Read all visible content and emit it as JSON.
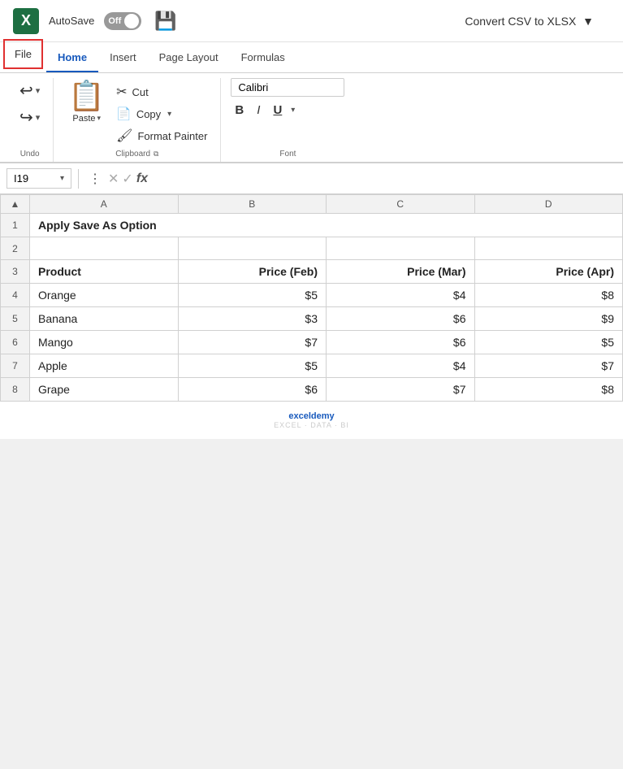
{
  "titlebar": {
    "logo": "X",
    "autosave_label": "AutoSave",
    "toggle_state": "Off",
    "title": "Convert CSV to XLSX",
    "dropdown_arrow": "▼"
  },
  "ribbon_tabs": {
    "tabs": [
      {
        "id": "file",
        "label": "File",
        "active": false,
        "highlighted": true
      },
      {
        "id": "home",
        "label": "Home",
        "active": true
      },
      {
        "id": "insert",
        "label": "Insert",
        "active": false
      },
      {
        "id": "page_layout",
        "label": "Page Layout",
        "active": false
      },
      {
        "id": "formulas",
        "label": "Formulas",
        "active": false
      }
    ]
  },
  "ribbon": {
    "undo_group": {
      "label": "Undo",
      "undo_icon": "↩",
      "redo_icon": "↪"
    },
    "clipboard_group": {
      "label": "Clipboard",
      "paste_label": "Paste",
      "cut_label": "Cut",
      "copy_label": "Copy",
      "format_painter_label": "Format Painter"
    },
    "font_group": {
      "label": "Font",
      "font_name": "Calibri",
      "bold_label": "B",
      "italic_label": "I",
      "underline_label": "U"
    }
  },
  "formula_bar": {
    "cell_ref": "I19",
    "fx_label": "fx"
  },
  "spreadsheet": {
    "col_headers": [
      "",
      "A",
      "B",
      "C",
      "D"
    ],
    "rows": [
      {
        "row_num": "1",
        "cells": [
          "Apply Save As Option",
          "",
          "",
          ""
        ]
      },
      {
        "row_num": "2",
        "cells": [
          "",
          "",
          "",
          ""
        ]
      },
      {
        "row_num": "3",
        "cells": [
          "Product",
          "Price (Feb)",
          "Price (Mar)",
          "Price (Apr)"
        ],
        "bold": true
      },
      {
        "row_num": "4",
        "cells": [
          "Orange",
          "$5",
          "$4",
          "$8"
        ]
      },
      {
        "row_num": "5",
        "cells": [
          "Banana",
          "$3",
          "$6",
          "$9"
        ]
      },
      {
        "row_num": "6",
        "cells": [
          "Mango",
          "$7",
          "$6",
          "$5"
        ]
      },
      {
        "row_num": "7",
        "cells": [
          "Apple",
          "$5",
          "$4",
          "$7"
        ]
      },
      {
        "row_num": "8",
        "cells": [
          "Grape",
          "$6",
          "$7",
          "$8"
        ]
      }
    ]
  },
  "watermark": {
    "brand": "exceldemy",
    "tagline": "EXCEL · DATA · BI"
  }
}
